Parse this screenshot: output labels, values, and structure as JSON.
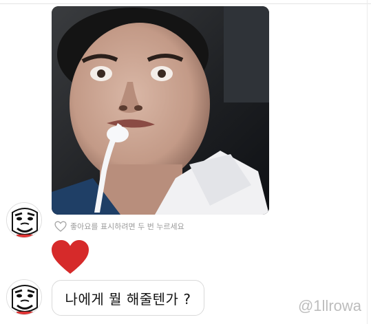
{
  "chat": {
    "like_hint_text": "좋아요를 표시하려면 두 번 누르세요",
    "reaction_icon": "heart-icon",
    "reaction_color": "#d62a2a",
    "message_text": "나에게 뭘 해줄텐가 ?",
    "watermark": "@1llrowa"
  },
  "colors": {
    "bubble_border": "#d9d9d9",
    "hint_text": "#9a9a9a",
    "watermark": "#bdbdbd"
  }
}
